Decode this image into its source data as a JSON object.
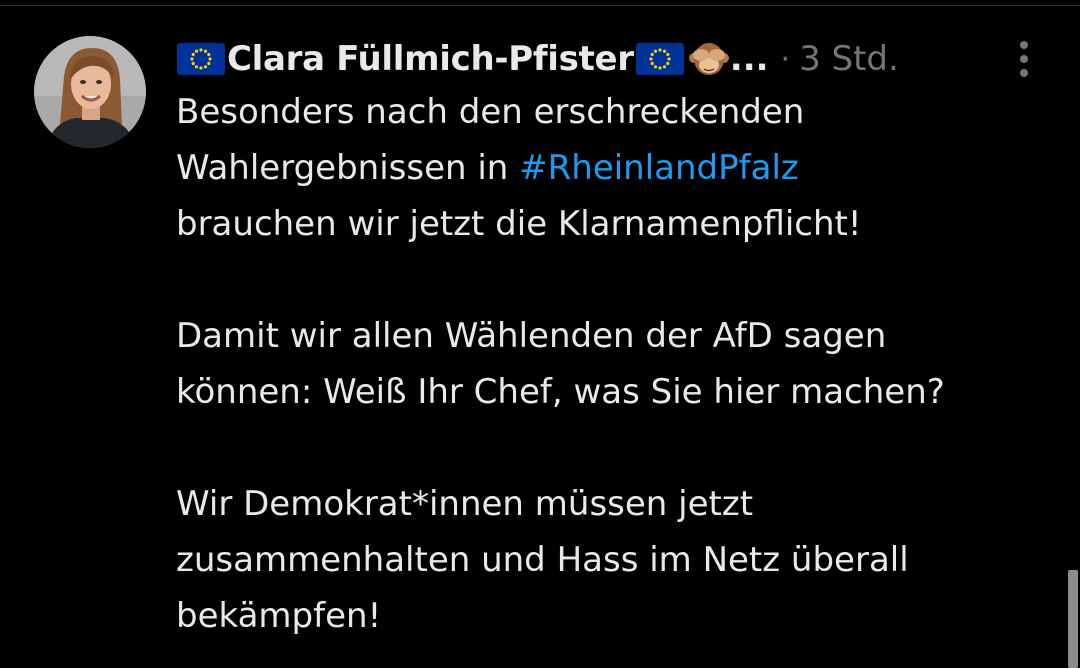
{
  "post": {
    "author": {
      "display_name": "Clara Füllmich-Pfister",
      "truncation": "...",
      "name_prefix_icon": "eu-flag-emoji",
      "name_suffix_icons": [
        "eu-flag-emoji",
        "see-no-evil-monkey-emoji"
      ]
    },
    "separator": "·",
    "timestamp": "3 Std.",
    "text": {
      "paragraph1": {
        "line1": "Besonders nach den erschreckenden",
        "line2_before": "Wahlergebnissen in ",
        "line2_hashtag": "#RheinlandPfalz",
        "line3": "brauchen wir jetzt die Klarnamenpflicht!"
      },
      "paragraph2": {
        "line1": "Damit wir allen Wählenden der AfD sagen",
        "line2": "können: Weiß Ihr Chef, was Sie hier machen?"
      },
      "paragraph3": {
        "line1": "Wir Demokrat*innen müssen jetzt",
        "line2": "zusammenhalten und Hass im Netz überall",
        "line3": "bekämpfen!"
      }
    },
    "more_icon": "more-vertical-icon"
  },
  "colors": {
    "background": "#000000",
    "text_primary": "#e7e9ea",
    "text_secondary": "#71767b",
    "link": "#1d9bf0",
    "eu_blue": "#003399",
    "eu_gold": "#ffcc00"
  }
}
